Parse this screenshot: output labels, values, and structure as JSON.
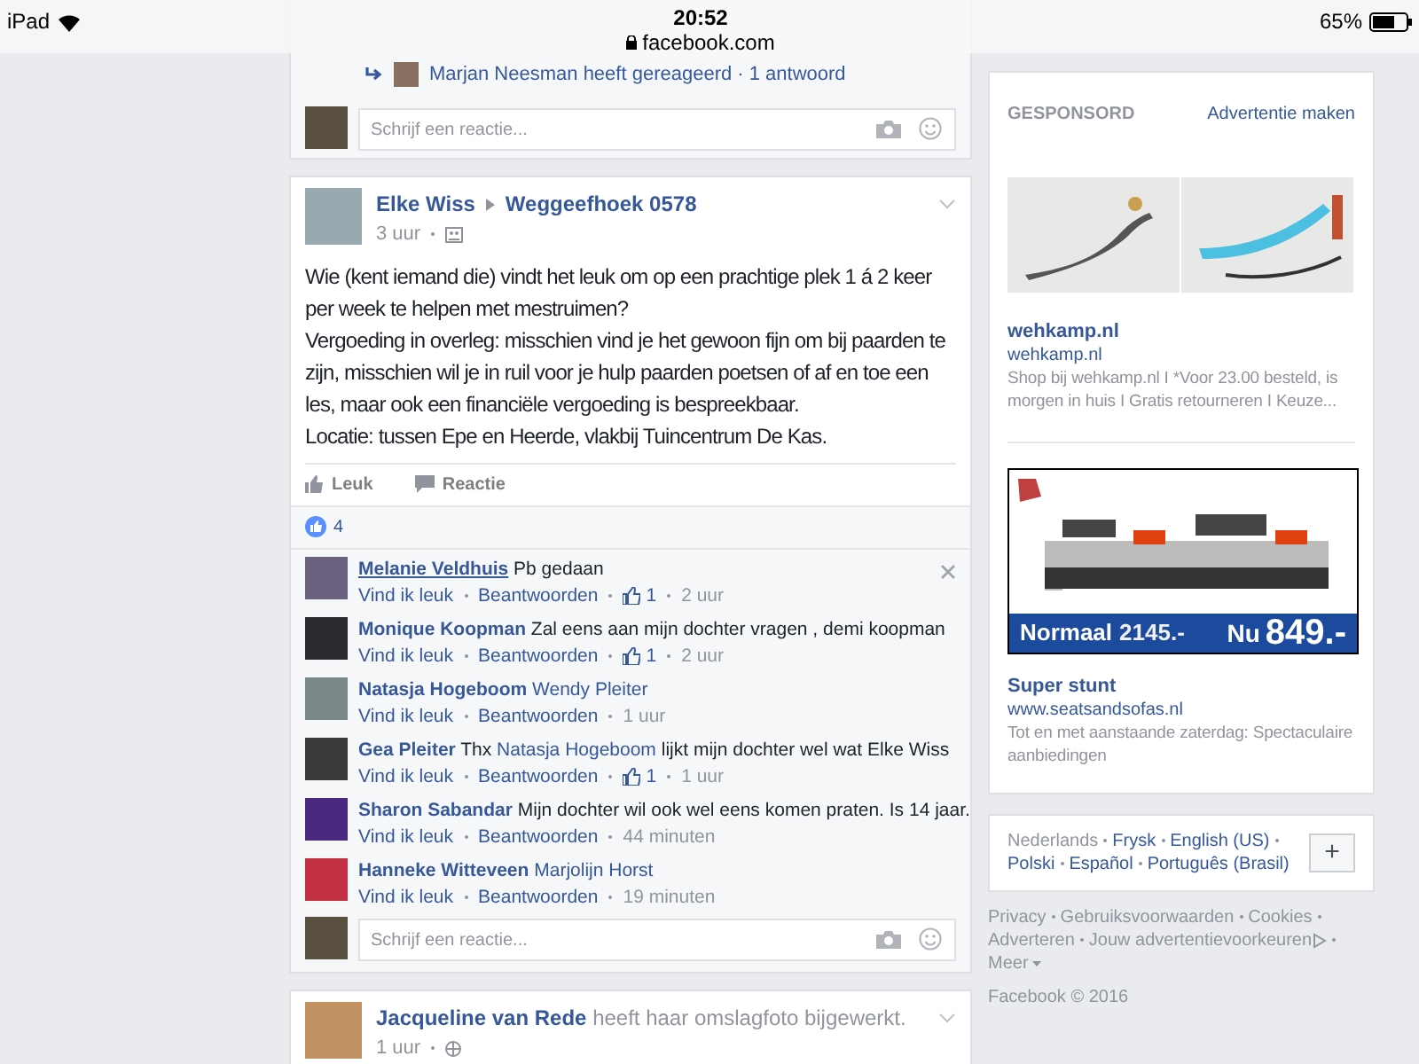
{
  "status_bar": {
    "device": "iPad",
    "time": "20:52",
    "url": "facebook.com",
    "battery": "65%"
  },
  "previous_post": {
    "reply_link": "Marjan Neesman heeft gereageerd · 1 antwoord",
    "comment_box": {
      "placeholder": "Schrijf een reactie..."
    }
  },
  "post": {
    "author": "Elke Wiss",
    "group": "Weggeefhoek 0578",
    "time": "3 uur",
    "body": [
      "Wie (kent iemand die) vindt het leuk om op een prachtige plek 1 á 2 keer per week te helpen met mestruimen?",
      "Vergoeding in overleg: misschien vind je het gewoon fijn om bij paarden te zijn, misschien wil je in ruil voor je hulp paarden poetsen of af en toe een les, maar ook een financiële vergoeding is bespreekbaar.",
      "Locatie: tussen Epe en Heerde, vlakbij Tuincentrum De Kas."
    ],
    "actions": [
      "Leuk",
      "Reactie"
    ],
    "like_count": "4",
    "comments": [
      {
        "author": "Melanie Veldhuis",
        "hovered": true,
        "segments": [
          {
            "kind": "plain",
            "text": "Pb gedaan"
          }
        ],
        "like": "Vind ik leuk",
        "reply": "Beantwoorden",
        "likes": "1",
        "time": "2 uur"
      },
      {
        "author": "Monique Koopman",
        "hovered": false,
        "segments": [
          {
            "kind": "plain",
            "text": "Zal eens aan mijn dochter vragen , demi koopman"
          }
        ],
        "like": "Vind ik leuk",
        "reply": "Beantwoorden",
        "likes": "1",
        "time": "2 uur"
      },
      {
        "author": "Natasja Hogeboom",
        "hovered": false,
        "segments": [
          {
            "kind": "mention",
            "text": "Wendy Pleiter"
          }
        ],
        "like": "Vind ik leuk",
        "reply": "Beantwoorden",
        "time": "1 uur"
      },
      {
        "author": "Gea Pleiter",
        "hovered": false,
        "segments": [
          {
            "kind": "plain",
            "text": "Thx"
          },
          {
            "kind": "mention",
            "text": "Natasja Hogeboom"
          },
          {
            "kind": "plain",
            "text": "lijkt mijn dochter wel wat Elke Wiss"
          }
        ],
        "like": "Vind ik leuk",
        "reply": "Beantwoorden",
        "likes": "1",
        "time": "1 uur"
      },
      {
        "author": "Sharon Sabandar",
        "hovered": false,
        "segments": [
          {
            "kind": "plain",
            "text": "Mijn dochter wil ook wel eens komen praten. Is 14 jaar."
          }
        ],
        "like": "Vind ik leuk",
        "reply": "Beantwoorden",
        "time": "44 minuten"
      },
      {
        "author": "Hanneke Witteveen",
        "hovered": false,
        "segments": [
          {
            "kind": "mention",
            "text": "Marjolijn Horst"
          }
        ],
        "like": "Vind ik leuk",
        "reply": "Beantwoorden",
        "time": "19 minuten"
      }
    ],
    "comment_box": {
      "placeholder": "Schrijf een reactie..."
    }
  },
  "next_post": {
    "author": "Jacqueline van Rede",
    "action": "heeft haar omslagfoto bijgewerkt.",
    "time": "1 uur"
  },
  "sponsored": {
    "title": "GESPONSORD",
    "create_link": "Advertentie maken",
    "ads": [
      {
        "kind": "double_image",
        "title": "wehkamp.nl",
        "url": "wehkamp.nl",
        "description": "Shop bij wehkamp.nl I *Voor 23.00 besteld, is morgen in huis I Gratis retourneren I Keuze..."
      },
      {
        "kind": "banner",
        "banner_label": "Normaal",
        "banner_old_price": "2145.-",
        "banner_now": "Nu",
        "banner_price": "849.-",
        "title": "Super stunt",
        "url": "www.seatsandsofas.nl",
        "description": "Tot en met aanstaande zaterdag: Spectaculaire aanbiedingen"
      }
    ]
  },
  "languages": {
    "current": "Nederlands",
    "others": [
      "Frysk",
      "English (US)",
      "Polski",
      "Español",
      "Português (Brasil)"
    ],
    "more_button": "+"
  },
  "footer": {
    "links": [
      "Privacy",
      "Gebruiksvoorwaarden",
      "Cookies",
      "Adverteren",
      "Jouw advertentievoorkeuren"
    ],
    "more": "Meer",
    "copyright": "Facebook © 2016"
  }
}
